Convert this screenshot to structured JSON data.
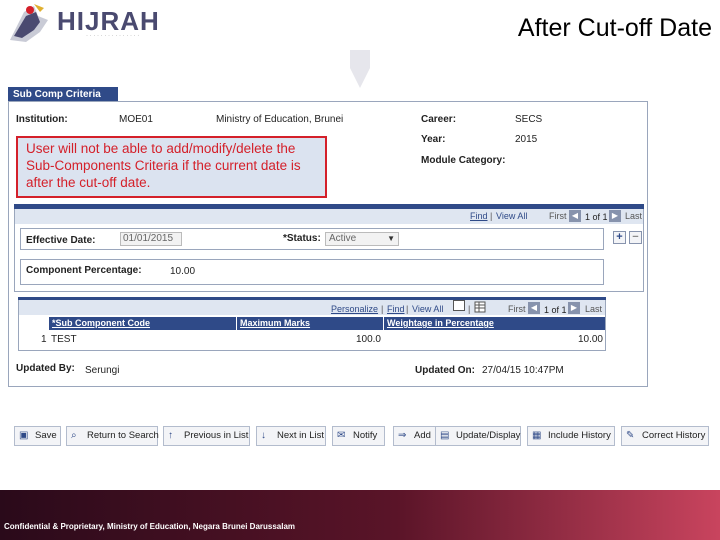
{
  "header": {
    "logo_text": "HIJRAH",
    "logo_sub": "· · · · · · · · · · · · · · ·",
    "slide_title": "After Cut-off Date"
  },
  "panel": {
    "tab_label": "Sub Comp Criteria",
    "institution_label": "Institution:",
    "institution_code": "MOE01",
    "institution_name": "Ministry of Education, Brunei",
    "career_label": "Career:",
    "career_value": "SECS",
    "year_label": "Year:",
    "year_value": "2015",
    "module_category_label": "Module Category:",
    "callout_text": "User will not be able to add/modify/delete the Sub-Components Criteria if the current date is after the cut-off date."
  },
  "effective": {
    "nav_find": "Find",
    "nav_view_all": "View All",
    "nav_first": "First",
    "nav_count": "1 of 1",
    "nav_last": "Last",
    "effective_date_label": "Effective Date:",
    "effective_date_value": "01/01/2015",
    "status_label": "*Status:",
    "status_value": "Active",
    "component_pct_label": "Component Percentage:",
    "component_pct_value": "10.00"
  },
  "grid": {
    "nav_personalize": "Personalize",
    "nav_find": "Find",
    "nav_view_all": "View All",
    "nav_first": "First",
    "nav_count": "1 of 1",
    "nav_last": "Last",
    "columns": [
      "*Sub Component Code",
      "Maximum Marks",
      "Weightage in Percentage"
    ],
    "rows": [
      {
        "num": "1",
        "code": "TEST",
        "max_marks": "100.0",
        "weightage": "10.00"
      }
    ]
  },
  "audit": {
    "updated_by_label": "Updated By:",
    "updated_by_value": "Serungi",
    "updated_on_label": "Updated On:",
    "updated_on_value": "27/04/15 10:47PM"
  },
  "toolbar": {
    "save": "Save",
    "return_to_search": "Return to Search",
    "previous_in_list": "Previous in List",
    "next_in_list": "Next in List",
    "notify": "Notify",
    "add": "Add",
    "update_display": "Update/Display",
    "include_history": "Include History",
    "correct_history": "Correct History"
  },
  "footer": {
    "text": "Confidential & Proprietary, Ministry of Education, Negara Brunei Darussalam"
  },
  "colors": {
    "brand_blue": "#2f4a88",
    "callout_red": "#d4202a",
    "footer_maroon": "#5a1428"
  }
}
